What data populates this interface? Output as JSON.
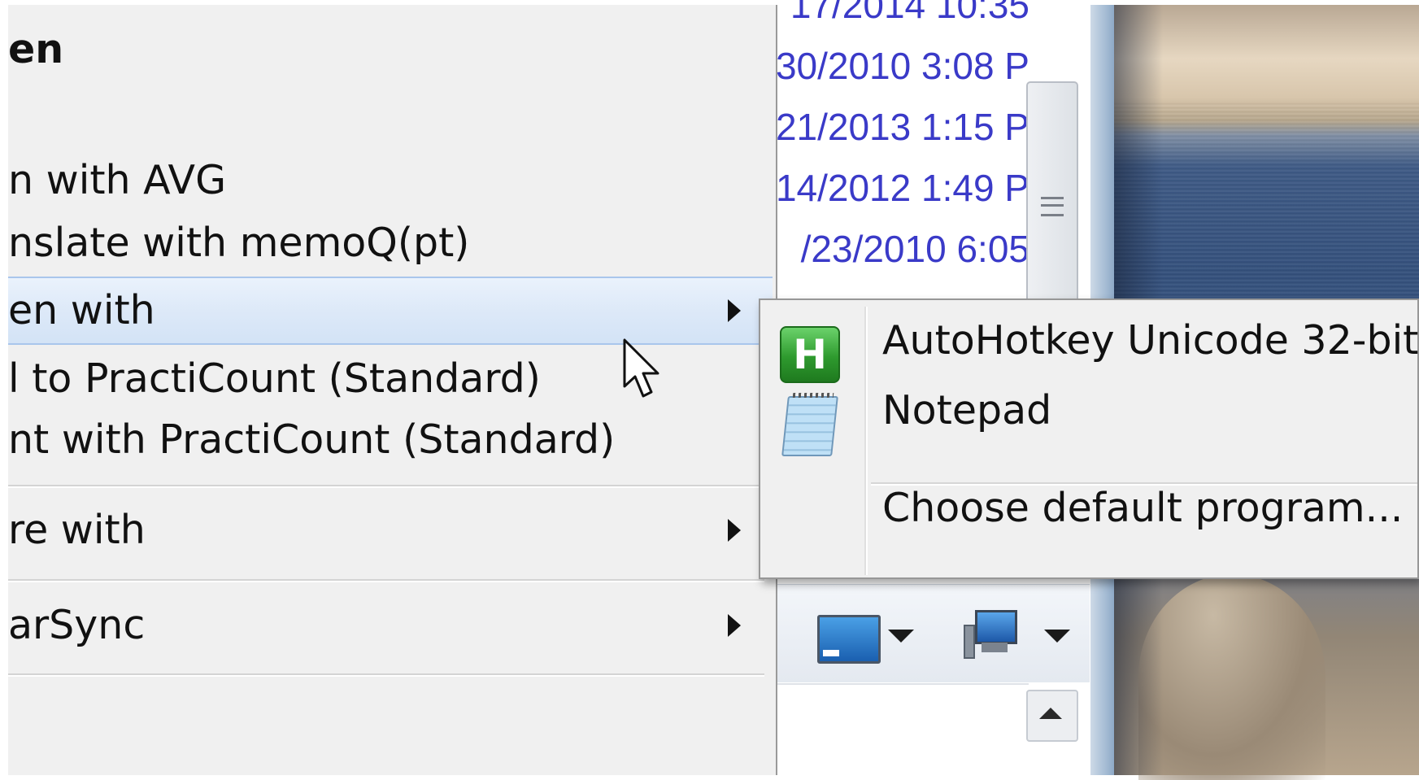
{
  "explorer": {
    "dates": [
      "17/2014 10:35",
      "30/2010 3:08 P",
      "21/2013 1:15 P",
      "14/2012 1:49 P",
      "/23/2010 6:05"
    ]
  },
  "context_menu": {
    "items": [
      {
        "label": "en",
        "bold": true
      },
      {
        "label": "n with AVG"
      },
      {
        "label": "nslate with memoQ(pt)"
      },
      {
        "label": "en with",
        "highlighted": true,
        "has_submenu": true
      },
      {
        "label": "l to PractiCount (Standard)"
      },
      {
        "label": "nt with PractiCount (Standard)"
      },
      {
        "label": "re with",
        "has_submenu": true
      },
      {
        "label": "arSync",
        "has_submenu": true
      }
    ]
  },
  "submenu": {
    "items": [
      {
        "label": "AutoHotkey Unicode 32-bit",
        "icon": "autohotkey-icon",
        "icon_glyph": "H"
      },
      {
        "label": "Notepad",
        "icon": "notepad-icon"
      },
      {
        "label": "Choose default program..."
      }
    ]
  },
  "colors": {
    "menu_bg": "#f0f0f0",
    "highlight_border": "#a9c6ec",
    "date_text": "#3a3ac8"
  }
}
